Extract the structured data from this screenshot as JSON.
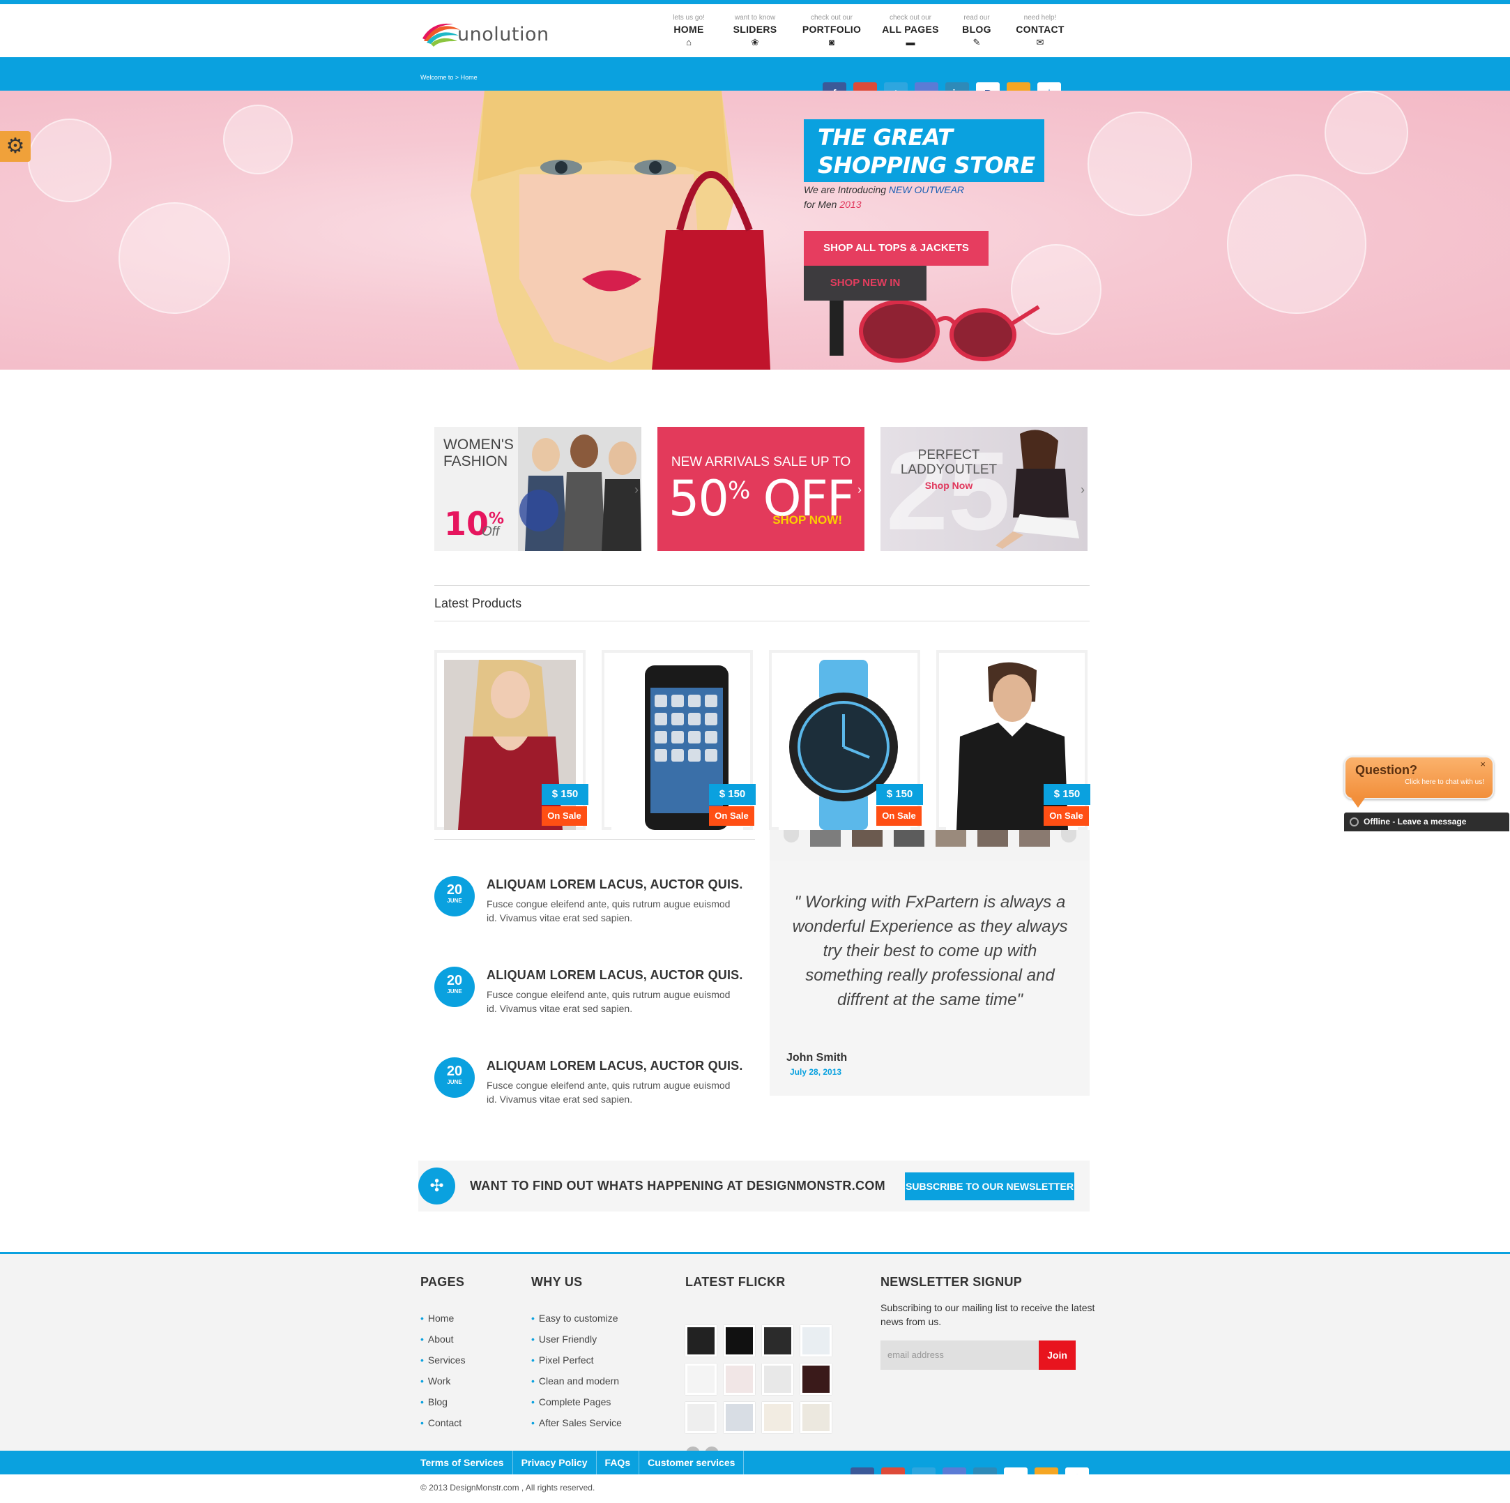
{
  "brand": {
    "name": "unolution"
  },
  "nav": [
    {
      "sub": "lets us go!",
      "label": "HOME",
      "icon": "home-icon",
      "glyph": "⌂"
    },
    {
      "sub": "want to know",
      "label": "SLIDERS",
      "icon": "paw-icon",
      "glyph": "❀"
    },
    {
      "sub": "check out our",
      "label": "PORTFOLIO",
      "icon": "camera-icon",
      "glyph": "◙"
    },
    {
      "sub": "check out our",
      "label": "ALL PAGES",
      "icon": "briefcase-icon",
      "glyph": "▬"
    },
    {
      "sub": "read our",
      "label": "BLOG",
      "icon": "pencil-icon",
      "glyph": "✎"
    },
    {
      "sub": "need help!",
      "label": "CONTACT",
      "icon": "envelope-icon",
      "glyph": "✉"
    }
  ],
  "breadcrumb": "Welcome to > Home",
  "social": [
    {
      "icon": "facebook-icon",
      "glyph": "f",
      "color": "#3b5998"
    },
    {
      "icon": "googleplus-icon",
      "glyph": "g+",
      "color": "#dd4b39"
    },
    {
      "icon": "twitter-icon",
      "glyph": "t",
      "color": "#2ea6df"
    },
    {
      "icon": "google-icon",
      "glyph": "g",
      "color": "#5b7bd5"
    },
    {
      "icon": "linkedin-icon",
      "glyph": "in",
      "color": "#2e8ab8"
    },
    {
      "icon": "paypal-icon",
      "glyph": "P",
      "color": "#ffffff"
    },
    {
      "icon": "amazon-icon",
      "glyph": "a",
      "color": "#f5a623"
    },
    {
      "icon": "dropbox-icon",
      "glyph": "✦",
      "color": "#ffffff"
    }
  ],
  "hero": {
    "title_line1": "THE GREAT",
    "title_line2": "SHOPPING STORE",
    "sub_prefix": "We are Introducing",
    "sub_highlight": "NEW OUTWEAR",
    "sub_line2_prefix": "for Men",
    "sub_year": "2013",
    "btn_primary": "SHOP ALL TOPS & JACKETS",
    "btn_secondary": "SHOP NEW IN"
  },
  "promos": {
    "p1_title": "WOMEN'S FASHION",
    "p1_pct": "10",
    "p1_pct_sign": "%",
    "p1_off": "Off",
    "p2_line1": "NEW ARRIVALS SALE UP TO",
    "p2_big_num": "50",
    "p2_big_sign": "%",
    "p2_big_word": "OFF",
    "p2_shop": "SHOP NOW!",
    "p3_title": "PERFECT LADDYOUTLET",
    "p3_shop": "Shop Now",
    "p3_num": "25"
  },
  "latest": {
    "title": "Latest Products",
    "products": [
      {
        "price": "$ 150",
        "badge": "On Sale",
        "kind": "dress"
      },
      {
        "price": "$ 150",
        "badge": "On Sale",
        "kind": "phone"
      },
      {
        "price": "$ 150",
        "badge": "On Sale",
        "kind": "watch"
      },
      {
        "price": "$ 150",
        "badge": "On Sale",
        "kind": "shirt"
      }
    ]
  },
  "news": [
    {
      "day": "20",
      "month": "JUNE",
      "title": "ALIQUAM LOREM LACUS, AUCTOR QUIS.",
      "body": "Fusce congue eleifend ante, quis rutrum augue euismod id. Vivamus vitae erat sed sapien."
    },
    {
      "day": "20",
      "month": "JUNE",
      "title": "ALIQUAM LOREM LACUS, AUCTOR QUIS.",
      "body": "Fusce congue eleifend ante, quis rutrum augue euismod id. Vivamus vitae erat sed sapien."
    },
    {
      "day": "20",
      "month": "JUNE",
      "title": "ALIQUAM LOREM LACUS, AUCTOR QUIS.",
      "body": "Fusce congue eleifend ante, quis rutrum augue euismod id. Vivamus vitae erat sed sapien."
    }
  ],
  "testimonial": {
    "quote": "\" Working with FxPartern is always a wonderful Experience as they always try their best to come up with something really professional and diffrent at the same time\"",
    "author": "John Smith",
    "date": "July 28, 2013"
  },
  "cta": {
    "text": "WANT TO FIND OUT WHATS HAPPENING AT DESIGNMONSTR.COM",
    "button": "SUBSCRIBE TO OUR NEWSLETTER"
  },
  "chat": {
    "question": "Question?",
    "subtext": "Click here to chat with us!",
    "close": "×",
    "offline": "Offline - Leave a message"
  },
  "footer": {
    "pages_title": "PAGES",
    "pages": [
      "Home",
      "About",
      "Services",
      "Work",
      "Blog",
      "Contact"
    ],
    "why_title": "WHY US",
    "why": [
      "Easy to customize",
      "User Friendly",
      "Pixel Perfect",
      "Clean and modern",
      "Complete Pages",
      "After Sales Service"
    ],
    "flickr_title": "LATEST FLICKR",
    "newsletter_title": "NEWSLETTER SIGNUP",
    "newsletter_text": "Subscribing to our mailing list to receive the latest news from us.",
    "email_placeholder": "email address",
    "join": "Join"
  },
  "bottom_links": [
    "Terms of Services",
    "Privacy Policy",
    "FAQs",
    "Customer services"
  ],
  "copyright": "© 2013 DesignMonstr.com , All rights reserved.",
  "colors": {
    "accent": "#0aa1df",
    "pink": "#e63d5f",
    "sale": "#ff4f14",
    "join": "#e8141e"
  }
}
